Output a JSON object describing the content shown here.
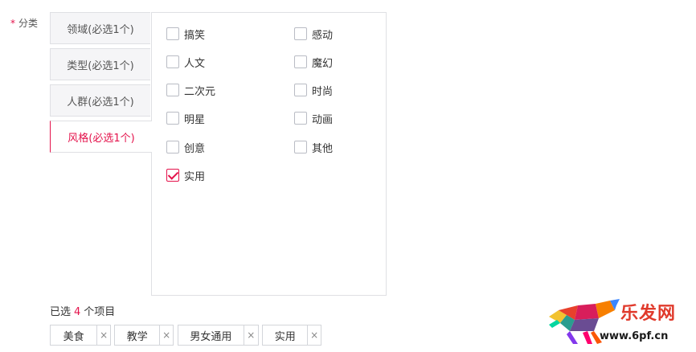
{
  "field": {
    "required_mark": "*",
    "label": "分类"
  },
  "tabs": [
    {
      "label": "领域(必选1个)",
      "active": false
    },
    {
      "label": "类型(必选1个)",
      "active": false
    },
    {
      "label": "人群(必选1个)",
      "active": false
    },
    {
      "label": "风格(必选1个)",
      "active": true
    }
  ],
  "options": [
    {
      "label": "搞笑",
      "checked": false
    },
    {
      "label": "感动",
      "checked": false
    },
    {
      "label": "人文",
      "checked": false
    },
    {
      "label": "魔幻",
      "checked": false
    },
    {
      "label": "二次元",
      "checked": false
    },
    {
      "label": "时尚",
      "checked": false
    },
    {
      "label": "明星",
      "checked": false
    },
    {
      "label": "动画",
      "checked": false
    },
    {
      "label": "创意",
      "checked": false
    },
    {
      "label": "其他",
      "checked": false
    },
    {
      "label": "实用",
      "checked": true
    }
  ],
  "selected": {
    "prefix": "已选",
    "count": "4",
    "suffix": "个项目"
  },
  "chips": [
    {
      "label": "美食",
      "remove": "×"
    },
    {
      "label": "教学",
      "remove": "×"
    },
    {
      "label": "男女通用",
      "remove": "×"
    },
    {
      "label": "实用",
      "remove": "×"
    }
  ],
  "watermark": {
    "title": "乐发网",
    "url": "www.6pf.cn"
  },
  "colors": {
    "accent": "#e4124b",
    "border": "#dfe0e4",
    "tab_bg": "#f5f5f7"
  }
}
